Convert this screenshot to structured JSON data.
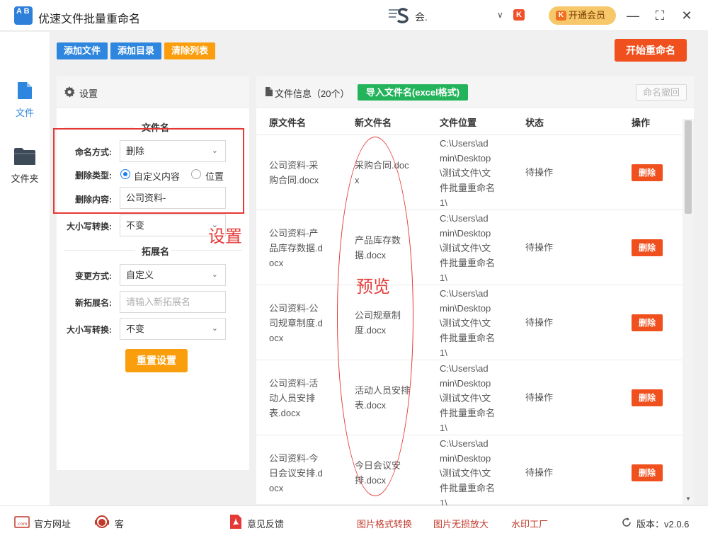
{
  "app": {
    "title": "优速文件批量重命名",
    "logo_text": "A B"
  },
  "titlebar": {
    "user_name": "会.",
    "user_dropdown": "∨",
    "vip_label": "开通会员",
    "minimize": "—",
    "maximize": "⛶",
    "close": "✕"
  },
  "nav": [
    {
      "label": "文件",
      "icon": "file-icon"
    },
    {
      "label": "文件夹",
      "icon": "folder-icon"
    }
  ],
  "toolbar": {
    "add_file": "添加文件",
    "add_dir": "添加目录",
    "clear_list": "清除列表",
    "start_rename": "开始重命名"
  },
  "settings": {
    "title": "设置",
    "filename_section": "文件名",
    "naming_method_label": "命名方式:",
    "naming_method_value": "删除",
    "delete_type_label": "删除类型:",
    "delete_type_options": [
      "自定义内容",
      "位置"
    ],
    "delete_type_selected": "自定义内容",
    "delete_content_label": "删除内容:",
    "delete_content_value": "公司资料-",
    "case_label": "大小写转换:",
    "case_value": "不变",
    "ext_section": "拓展名",
    "change_method_label": "变更方式:",
    "change_method_value": "自定义",
    "new_ext_label": "新拓展名:",
    "new_ext_placeholder": "请输入新拓展名",
    "ext_case_label": "大小写转换:",
    "ext_case_value": "不变",
    "reset_button": "重置设置"
  },
  "annotations": {
    "setup": "设置",
    "preview": "预览"
  },
  "files": {
    "title": "文件信息（20个）",
    "import_button": "导入文件名(excel格式)",
    "undo_button": "命名撤回",
    "columns": [
      "原文件名",
      "新文件名",
      "文件位置",
      "状态",
      "操作"
    ],
    "rows": [
      {
        "orig": [
          "公司资料-采",
          "购合同.docx"
        ],
        "new": [
          "采购合同.doc",
          "x"
        ],
        "loc": [
          "C:\\Users\\ad",
          "min\\Desktop",
          "\\测试文件\\文",
          "件批量重命名",
          "1\\"
        ],
        "status": "待操作",
        "action": "删除"
      },
      {
        "orig": [
          "公司资料-产",
          "品库存数据.d",
          "ocx"
        ],
        "new": [
          "产品库存数",
          "据.docx"
        ],
        "loc": [
          "C:\\Users\\ad",
          "min\\Desktop",
          "\\测试文件\\文",
          "件批量重命名",
          "1\\"
        ],
        "status": "待操作",
        "action": "删除"
      },
      {
        "orig": [
          "公司资料-公",
          "司规章制度.d",
          "ocx"
        ],
        "new": [
          "公司规章制",
          "度.docx"
        ],
        "loc": [
          "C:\\Users\\ad",
          "min\\Desktop",
          "\\测试文件\\文",
          "件批量重命名",
          "1\\"
        ],
        "status": "待操作",
        "action": "删除"
      },
      {
        "orig": [
          "公司资料-活",
          "动人员安排",
          "表.docx"
        ],
        "new": [
          "活动人员安排",
          "表.docx"
        ],
        "loc": [
          "C:\\Users\\ad",
          "min\\Desktop",
          "\\测试文件\\文",
          "件批量重命名",
          "1\\"
        ],
        "status": "待操作",
        "action": "删除"
      },
      {
        "orig": [
          "公司资料-今",
          "日会议安排.d",
          "ocx"
        ],
        "new": [
          "今日会议安",
          "排.docx"
        ],
        "loc": [
          "C:\\Users\\ad",
          "min\\Desktop",
          "\\测试文件\\文",
          "件批量重命名",
          "1\\"
        ],
        "status": "待操作",
        "action": "删除"
      }
    ]
  },
  "footer": {
    "official_site": "官方网址",
    "customer_service": "客",
    "feedback": "意见反馈",
    "img_convert": "图片格式转换",
    "img_enlarge": "图片无损放大",
    "watermark": "水印工厂",
    "version": "版本：v2.0.6"
  },
  "colors": {
    "primary_blue": "#2e86de",
    "orange": "#fa9e0e",
    "red": "#f0501e",
    "green": "#23b35a"
  }
}
